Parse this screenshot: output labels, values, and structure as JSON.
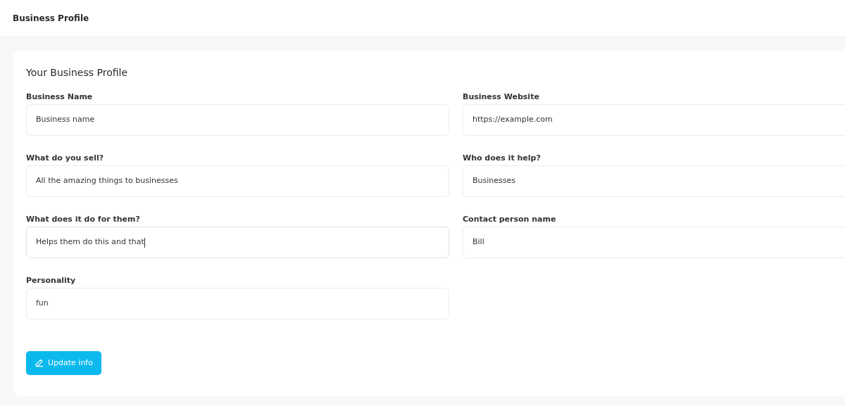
{
  "header": {
    "title": "Business Profile"
  },
  "card": {
    "title": "Your Business Profile",
    "fields": [
      {
        "label": "Business Name",
        "value": "Business name",
        "focused": false
      },
      {
        "label": "Business Website",
        "value": "https://example.com",
        "focused": false
      },
      {
        "label": "What do you sell?",
        "value": "All the amazing things to businesses",
        "focused": false
      },
      {
        "label": "Who does it help?",
        "value": "Businesses",
        "focused": false
      },
      {
        "label": "What does it do for them?",
        "value": "Helps them do this and that",
        "focused": true
      },
      {
        "label": "Contact person name",
        "value": "Bill",
        "focused": false
      },
      {
        "label": "Personality",
        "value": "fun",
        "focused": false
      }
    ],
    "button": {
      "label": "Update info"
    }
  }
}
